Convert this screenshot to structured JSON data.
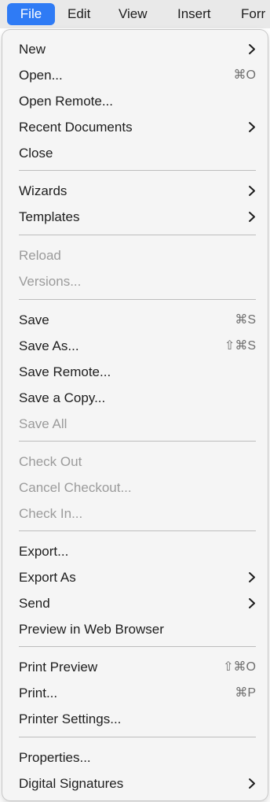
{
  "menubar": {
    "file": "File",
    "edit": "Edit",
    "view": "View",
    "insert": "Insert",
    "format": "Forr"
  },
  "menu": {
    "new": "New",
    "open": "Open...",
    "open_shortcut": "⌘O",
    "open_remote": "Open Remote...",
    "recent_documents": "Recent Documents",
    "close": "Close",
    "wizards": "Wizards",
    "templates": "Templates",
    "reload": "Reload",
    "versions": "Versions...",
    "save": "Save",
    "save_shortcut": "⌘S",
    "save_as": "Save As...",
    "save_as_shortcut": "⇧⌘S",
    "save_remote": "Save Remote...",
    "save_copy": "Save a Copy...",
    "save_all": "Save All",
    "check_out": "Check Out",
    "cancel_checkout": "Cancel Checkout...",
    "check_in": "Check In...",
    "export": "Export...",
    "export_as": "Export As",
    "send": "Send",
    "preview_web": "Preview in Web Browser",
    "print_preview": "Print Preview",
    "print_preview_shortcut": "⇧⌘O",
    "print": "Print...",
    "print_shortcut": "⌘P",
    "printer_settings": "Printer Settings...",
    "properties": "Properties...",
    "digital_signatures": "Digital Signatures"
  },
  "colors": {
    "accent": "#2f7bf5",
    "menu_bg": "#f5f5f5",
    "disabled_text": "#9b9b9b"
  },
  "icons": {
    "submenu": "chevron-right-icon"
  }
}
